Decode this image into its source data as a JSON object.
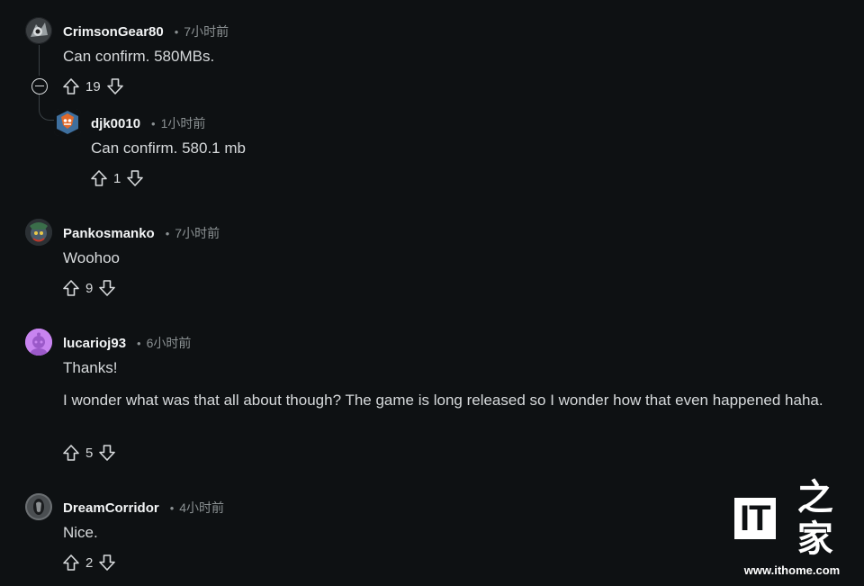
{
  "comments": [
    {
      "author": "CrimsonGear80",
      "time": "7小时前",
      "body": [
        "Can confirm. 580MBs."
      ],
      "score": "19"
    },
    {
      "author": "djk0010",
      "time": "1小时前",
      "body": [
        "Can confirm. 580.1 mb"
      ],
      "score": "1"
    },
    {
      "author": "Pankosmanko",
      "time": "7小时前",
      "body": [
        "Woohoo"
      ],
      "score": "9"
    },
    {
      "author": "lucarioj93",
      "time": "6小时前",
      "body": [
        "Thanks!",
        "I wonder what was that all about though? The game is long released so I wonder how that even happened haha."
      ],
      "score": "5"
    },
    {
      "author": "DreamCorridor",
      "time": "4小时前",
      "body": [
        "Nice."
      ],
      "score": "2"
    }
  ],
  "meta_separator": "•",
  "icons": {
    "upvote": "arrow-up-outline",
    "downvote": "arrow-down-outline",
    "collapse": "circle-minus"
  },
  "watermark": {
    "logo_text": "IT",
    "logo_chinese": "之家",
    "url": "www.ithome.com"
  },
  "colors": {
    "background": "#0e1113",
    "text": "#d7dadc",
    "muted": "#8b9193",
    "lucario_avatar": "#c884f0"
  }
}
